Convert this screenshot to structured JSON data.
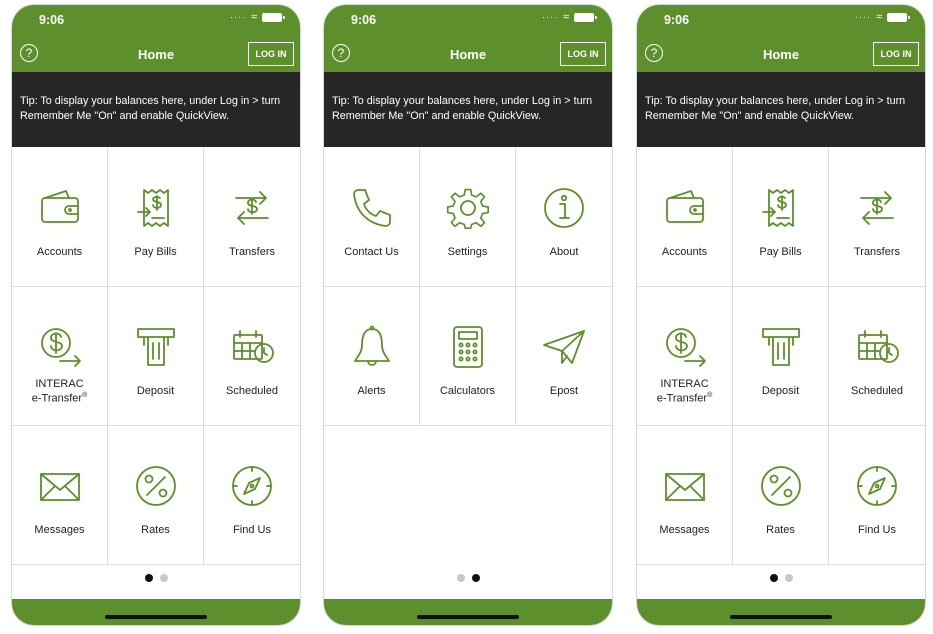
{
  "screens": [
    {
      "time": "9:06",
      "title": "Home",
      "login": "LOG IN",
      "help": "?",
      "tip": "Tip: To display your balances here, under Log in > turn Remember Me \"On\" and enable QuickView.",
      "items": [
        {
          "label": "Accounts",
          "icon": "wallet-icon"
        },
        {
          "label": "Pay Bills",
          "icon": "bill-icon"
        },
        {
          "label": "Transfers",
          "icon": "transfer-icon"
        },
        {
          "label": "INTERAC",
          "label2": "e-Transfer",
          "sup": "®",
          "icon": "etransfer-icon"
        },
        {
          "label": "Deposit",
          "icon": "deposit-icon"
        },
        {
          "label": "Scheduled",
          "icon": "scheduled-icon"
        },
        {
          "label": "Messages",
          "icon": "envelope-icon"
        },
        {
          "label": "Rates",
          "icon": "percent-icon"
        },
        {
          "label": "Find Us",
          "icon": "compass-icon"
        }
      ],
      "page_active": 0
    },
    {
      "time": "9:06",
      "title": "Home",
      "login": "LOG IN",
      "help": "?",
      "tip": "Tip: To display your balances here, under Log in > turn Remember Me \"On\" and enable QuickView.",
      "items": [
        {
          "label": "Contact Us",
          "icon": "phone-icon"
        },
        {
          "label": "Settings",
          "icon": "gear-icon"
        },
        {
          "label": "About",
          "icon": "info-icon"
        },
        {
          "label": "Alerts",
          "icon": "bell-icon"
        },
        {
          "label": "Calculators",
          "icon": "calculator-icon"
        },
        {
          "label": "Epost",
          "icon": "paper-plane-icon"
        }
      ],
      "page_active": 1
    },
    {
      "time": "9:06",
      "title": "Home",
      "login": "LOG IN",
      "help": "?",
      "tip": "Tip: To display your balances here, under Log in > turn Remember Me \"On\" and enable QuickView.",
      "items": [
        {
          "label": "Accounts",
          "icon": "wallet-icon"
        },
        {
          "label": "Pay Bills",
          "icon": "bill-icon"
        },
        {
          "label": "Transfers",
          "icon": "transfer-icon"
        },
        {
          "label": "INTERAC",
          "label2": "e-Transfer",
          "sup": "®",
          "icon": "etransfer-icon"
        },
        {
          "label": "Deposit",
          "icon": "deposit-icon"
        },
        {
          "label": "Scheduled",
          "icon": "scheduled-icon"
        },
        {
          "label": "Messages",
          "icon": "envelope-icon"
        },
        {
          "label": "Rates",
          "icon": "percent-icon"
        },
        {
          "label": "Find Us",
          "icon": "compass-icon"
        }
      ],
      "page_active": 0
    }
  ],
  "colors": {
    "brand_green": "#5d8f2c",
    "tip_bg": "#262626"
  }
}
